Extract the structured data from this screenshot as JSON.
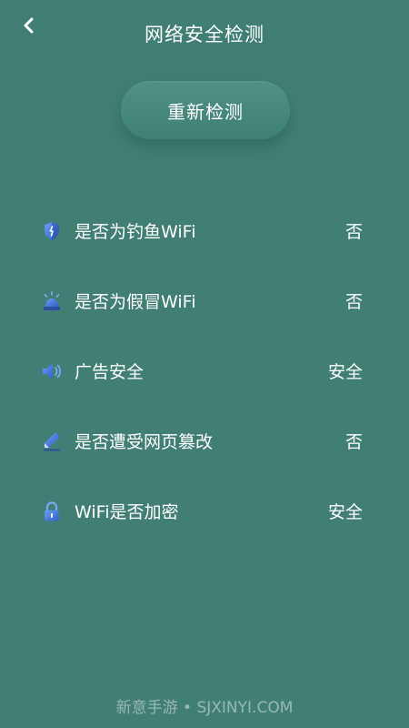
{
  "header": {
    "back_icon": "chevron-left-icon",
    "title": "网络安全检测"
  },
  "actions": {
    "recheck_label": "重新检测"
  },
  "checks": [
    {
      "icon": "shield-icon",
      "label": "是否为钓鱼WiFi",
      "value": "否"
    },
    {
      "icon": "alarm-light-icon",
      "label": "是否为假冒WiFi",
      "value": "否"
    },
    {
      "icon": "speaker-icon",
      "label": "广告安全",
      "value": "安全"
    },
    {
      "icon": "pencil-icon",
      "label": "是否遭受网页篡改",
      "value": "否"
    },
    {
      "icon": "lock-icon",
      "label": "WiFi是否加密",
      "value": "安全"
    }
  ],
  "footer": {
    "watermark": "新意手游 • SJXINYI.COM"
  },
  "colors": {
    "background": "#417e73",
    "icon_blue": "#4a7fe0",
    "text": "#ffffff"
  }
}
